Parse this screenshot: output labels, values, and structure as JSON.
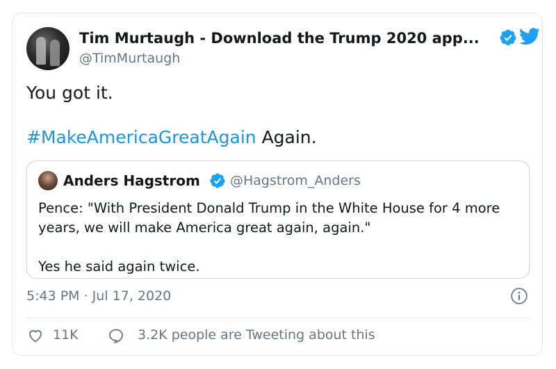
{
  "tweet": {
    "author_name": "Tim Murtaugh - Download the Trump 2020 app...",
    "author_handle": "@TimMurtaugh",
    "text_line1": "You got it.",
    "hashtag": "#MakeAmericaGreatAgain",
    "text_line2_rest": " Again.",
    "timestamp": "5:43 PM · Jul 17, 2020",
    "like_count": "11K",
    "talking_text": "3.2K people are Tweeting about this"
  },
  "quoted_tweet": {
    "author_name": "Anders Hagstrom",
    "author_handle": "@Hagstrom_Anders",
    "text_para1": "Pence: \"With President Donald Trump in the White House for 4 more years, we will make America great again, again.\"",
    "text_para2": "Yes he said again twice."
  },
  "colors": {
    "accent": "#1da1f2",
    "hashtag": "#1b95e0",
    "secondary_text": "#657786",
    "border": "#e1e8ed"
  },
  "icons": [
    "verified-badge-icon",
    "twitter-bird-icon",
    "info-icon",
    "heart-icon",
    "speech-bubble-icon"
  ]
}
